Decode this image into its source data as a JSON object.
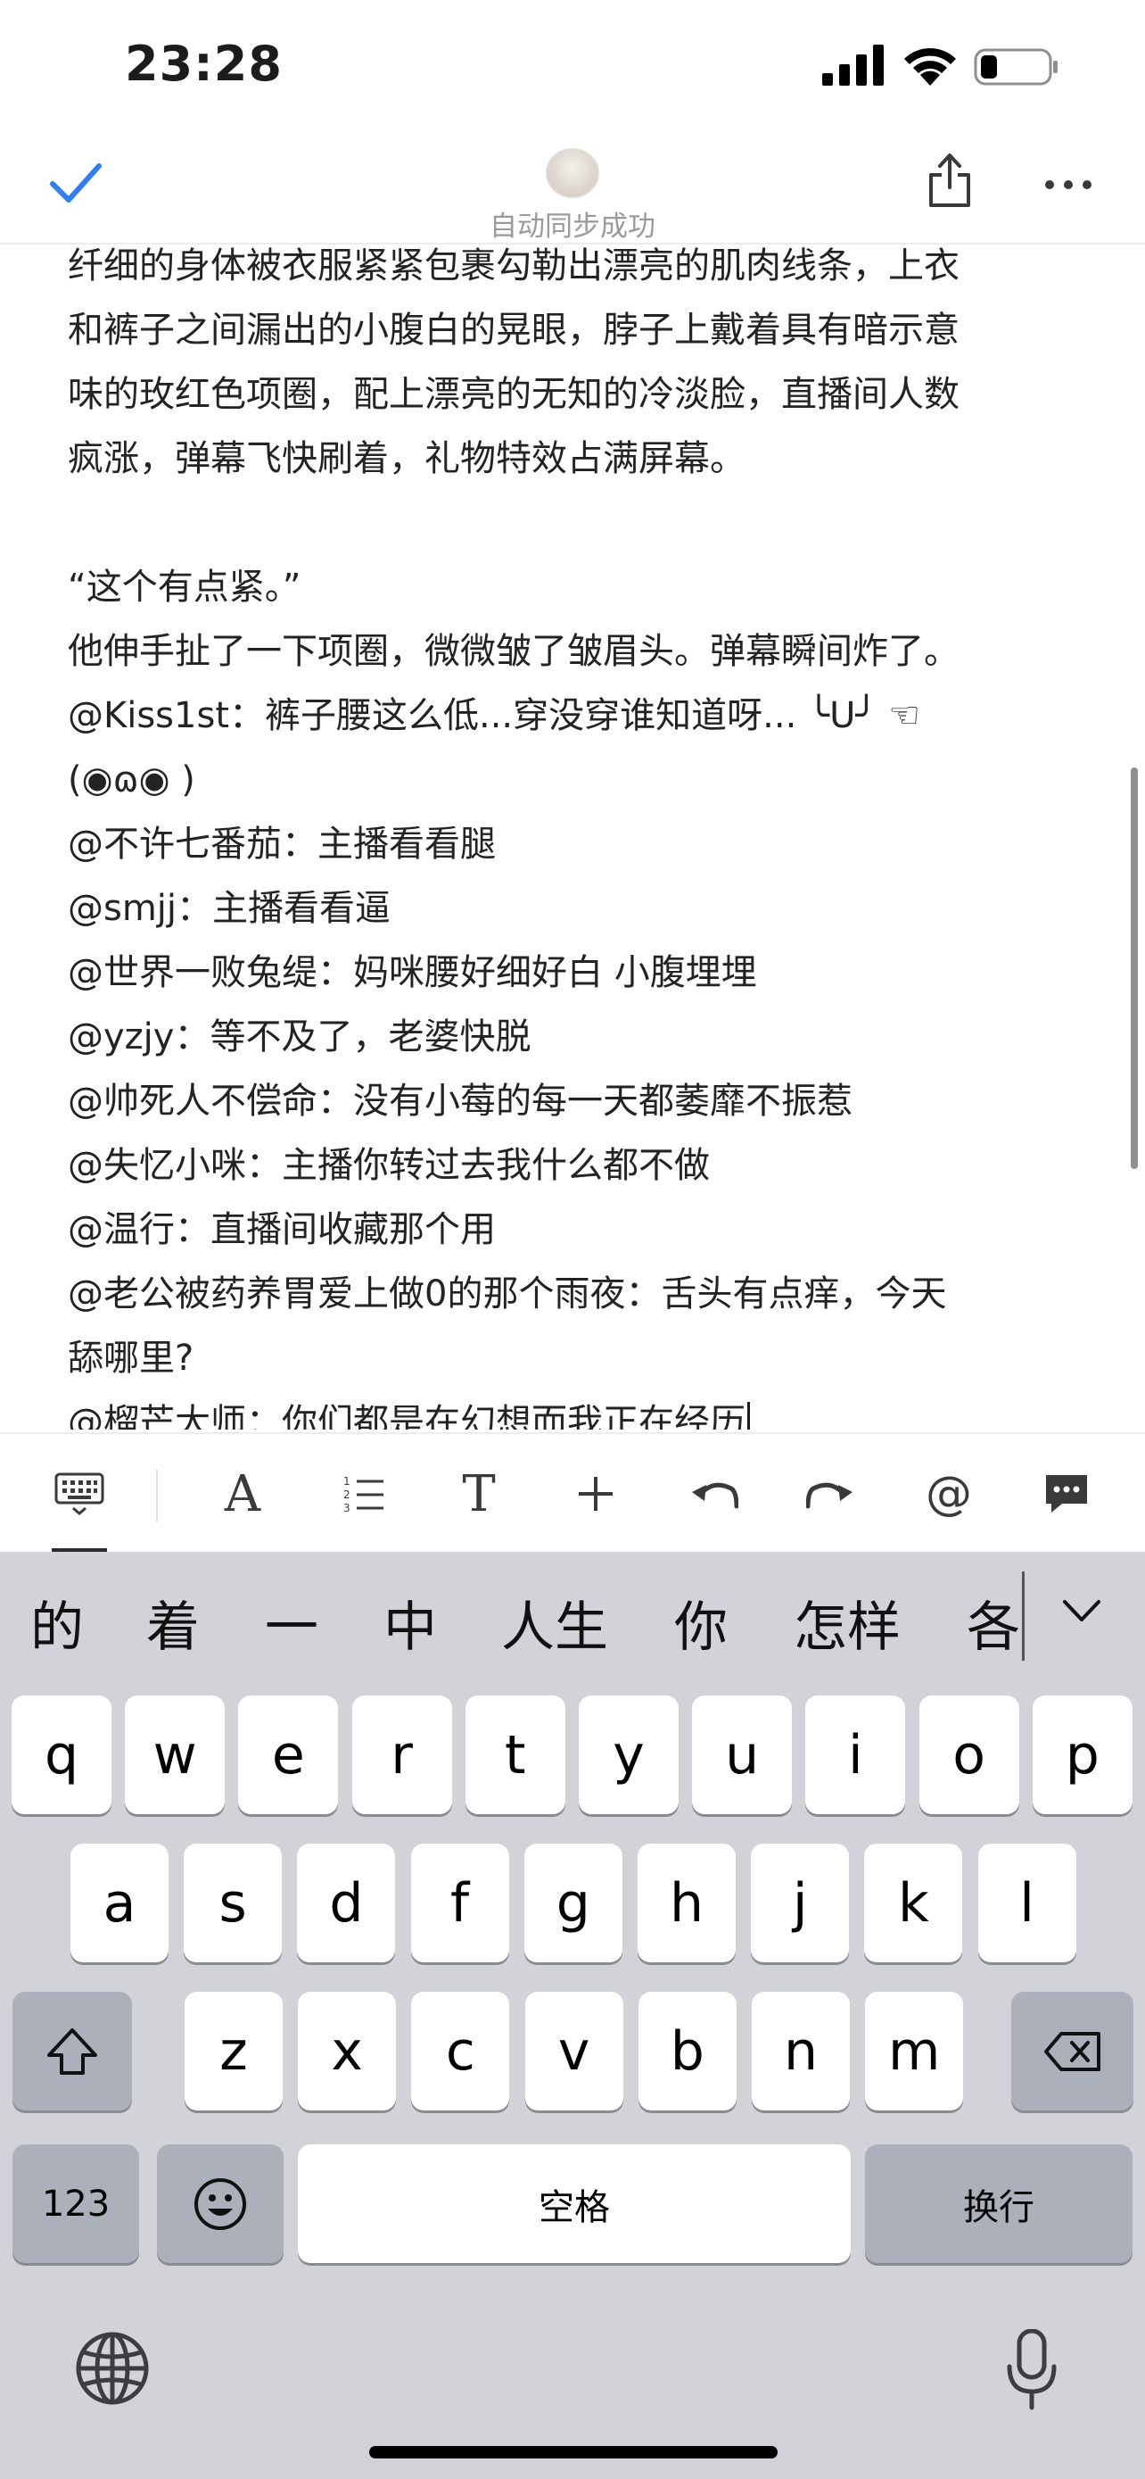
{
  "status_bar": {
    "time": "23:28"
  },
  "nav": {
    "sync_label": "自动同步成功"
  },
  "document": {
    "lines": [
      "纤细的身体被衣服紧紧包裹勾勒出漂亮的肌肉线条，上衣",
      "和裤子之间漏出的小腹白的晃眼，脖子上戴着具有暗示意",
      "味的玫红色项圈，配上漂亮的无知的冷淡脸，直播间人数",
      "疯涨，弹幕飞快刷着，礼物特效占满屏幕。",
      "",
      "“这个有点紧。”",
      "他伸手扯了一下项圈，微微皱了皱眉头。弹幕瞬间炸了。",
      "@Kiss1st：裤子腰这么低...穿没穿谁知道呀... ╰U╯ ☜",
      "(◉ɷ◉ )",
      "@不许七番茄：主播看看腿",
      "@smjj：主播看看逼",
      "@世界一败兔缇：妈咪腰好细好白 小腹埋埋",
      "@yzjy：等不及了，老婆快脱",
      "@帅死人不偿命：没有小莓的每一天都萎靡不振惹",
      "@失忆小咪：主播你转过去我什么都不做",
      "@温行：直播间收藏那个用",
      "@老公被药养胃爱上做0的那个雨夜：舌头有点痒，今天",
      "舔哪里?",
      "@榴芒大师：你们都是在幻想而我正在经历"
    ]
  },
  "toolbar": {
    "items": [
      "keyboard-icon",
      "font-icon",
      "numbered-list-icon",
      "text-style-icon",
      "insert-icon",
      "undo-icon",
      "redo-icon",
      "mention-icon",
      "comment-icon"
    ],
    "font_glyph": "A",
    "text_glyph": "T",
    "plus_glyph": "+",
    "at_glyph": "@"
  },
  "keyboard": {
    "candidates": [
      "的",
      "着",
      "一",
      "中",
      "人生",
      "你",
      "怎样",
      "各"
    ],
    "row1": [
      "q",
      "w",
      "e",
      "r",
      "t",
      "y",
      "u",
      "i",
      "o",
      "p"
    ],
    "row2": [
      "a",
      "s",
      "d",
      "f",
      "g",
      "h",
      "j",
      "k",
      "l"
    ],
    "row3": [
      "z",
      "x",
      "c",
      "v",
      "b",
      "n",
      "m"
    ],
    "numbers_label": "123",
    "space_label": "空格",
    "return_label": "换行"
  }
}
